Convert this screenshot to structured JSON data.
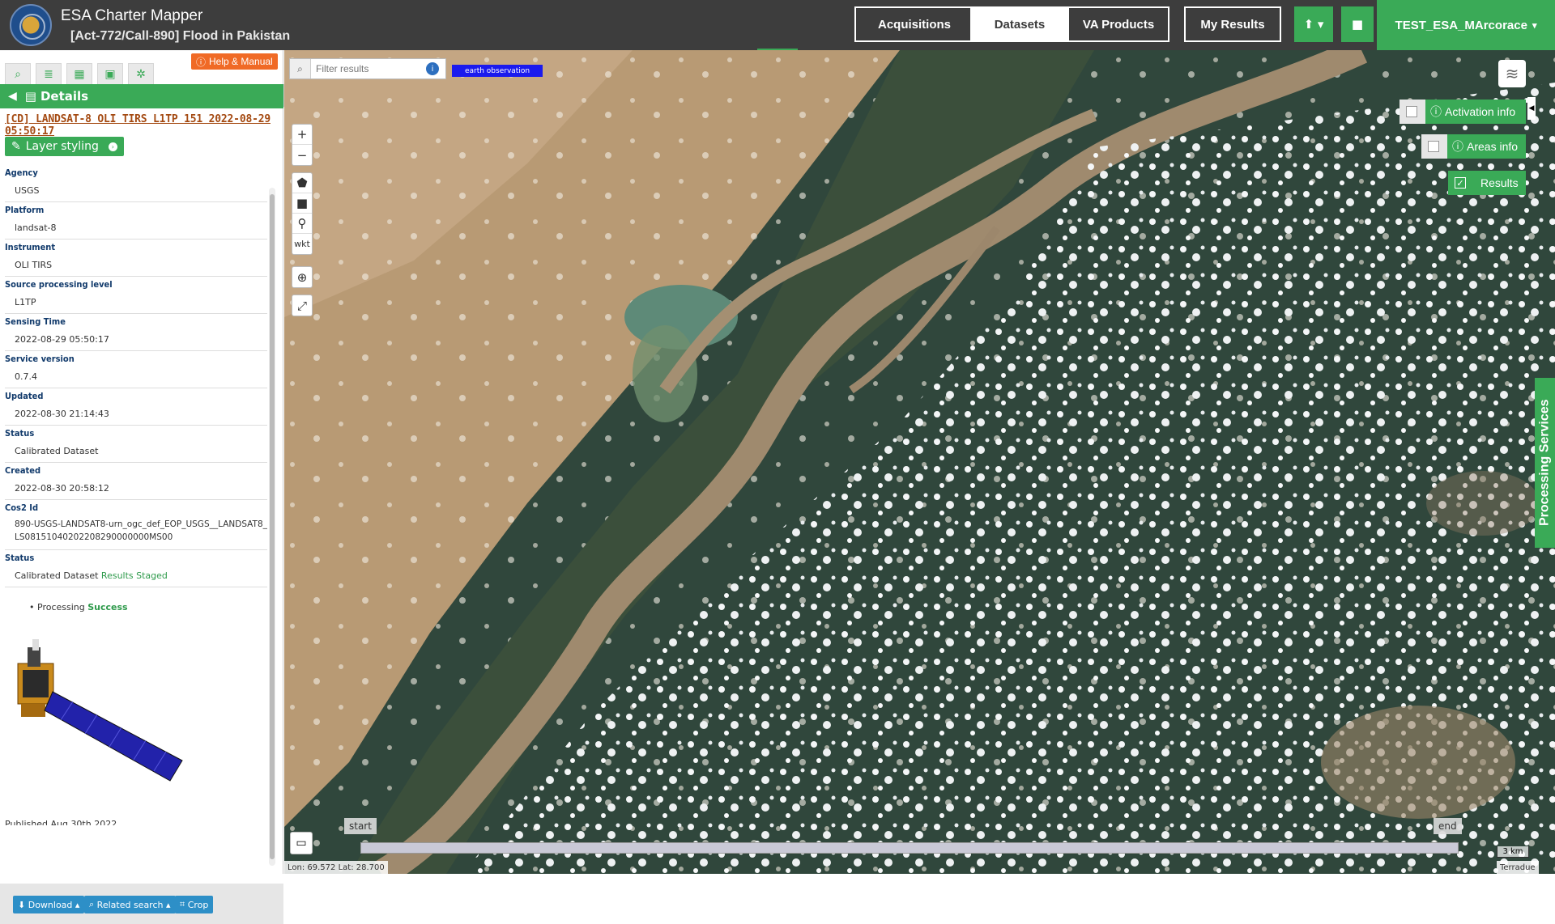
{
  "header": {
    "title": "ESA Charter Mapper",
    "subtitle": "[Act-772/Call-890] Flood in Pakistan",
    "nav": [
      "Acquisitions",
      "Datasets",
      "VA Products",
      "My Results"
    ],
    "active_nav": "Datasets",
    "user": "TEST_ESA_MArcorace"
  },
  "left_panel": {
    "help_label": "Help & Manual",
    "details_label": "Details",
    "record_title": "[CD] LANDSAT-8 OLI TIRS L1TP 151 2022-08-29 05:50:17",
    "styling_label": "Layer styling",
    "fields": [
      {
        "label": "Agency",
        "value": "USGS"
      },
      {
        "label": "Platform",
        "value": "landsat-8"
      },
      {
        "label": "Instrument",
        "value": "OLI TIRS"
      },
      {
        "label": "Source processing level",
        "value": "L1TP"
      },
      {
        "label": "Sensing Time",
        "value": "2022-08-29 05:50:17"
      },
      {
        "label": "Service version",
        "value": "0.7.4"
      },
      {
        "label": "Updated",
        "value": "2022-08-30 21:14:43"
      },
      {
        "label": "Status",
        "value": "Calibrated Dataset"
      },
      {
        "label": "Created",
        "value": "2022-08-30 20:58:12"
      },
      {
        "label": "Cos2 Id",
        "value": "890-USGS-LANDSAT8-urn_ogc_def_EOP_USGS__LANDSAT8_LS08151040202208290000000MS00"
      }
    ],
    "status2": {
      "label": "Status",
      "value": "Calibrated Dataset",
      "extra": "Results Staged"
    },
    "processing": {
      "label": "Processing",
      "value": "Success"
    },
    "published": "Published Aug 30th 2022",
    "bottom_buttons": [
      "Download",
      "Related search",
      "Crop"
    ]
  },
  "map": {
    "filter_placeholder": "Filter results",
    "tag": "earth observation",
    "draw_wkt": "wkt",
    "overlays": [
      {
        "label": "Activation info",
        "checked": false
      },
      {
        "label": "Areas info",
        "checked": false
      },
      {
        "label": "Results",
        "checked": true
      }
    ],
    "processing_services": "Processing Services",
    "timeline_start": "start",
    "timeline_end": "end",
    "scale": "3 km",
    "coords": "Lon: 69.572 Lat: 28.700",
    "attribution": "Terradue"
  },
  "colors": {
    "accent": "#3aaa57",
    "header": "#3d3d3d",
    "help": "#f06a26",
    "link_blue": "#2d8fc7"
  }
}
